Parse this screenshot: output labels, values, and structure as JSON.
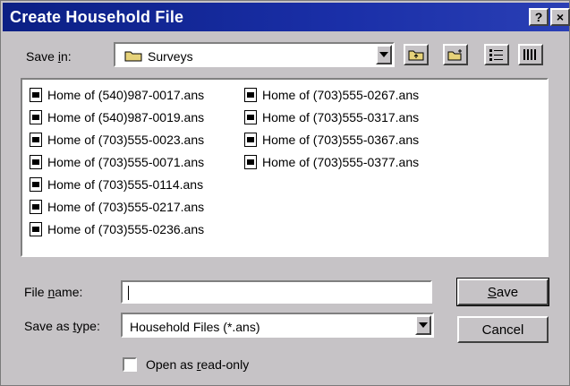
{
  "window": {
    "title": "Create Household File",
    "help_label": "?",
    "close_label": "×"
  },
  "save_in": {
    "label_pre": "Save ",
    "label_u": "i",
    "label_post": "n:",
    "value": "Surveys"
  },
  "toolbar": {
    "up_one_level_icon": "up-folder-icon",
    "new_folder_icon": "new-folder-icon",
    "list_view_icon": "list-view-icon",
    "details_view_icon": "details-view-icon"
  },
  "files": [
    "Home of (540)987-0017.ans",
    "Home of (540)987-0019.ans",
    "Home of (703)555-0023.ans",
    "Home of (703)555-0071.ans",
    "Home of (703)555-0114.ans",
    "Home of (703)555-0217.ans",
    "Home of (703)555-0236.ans",
    "Home of (703)555-0267.ans",
    "Home of (703)555-0317.ans",
    "Home of (703)555-0367.ans",
    "Home of (703)555-0377.ans"
  ],
  "file_name": {
    "label_pre": "File ",
    "label_u": "n",
    "label_post": "ame:",
    "value": ""
  },
  "save_as_type": {
    "label_pre": "Save as ",
    "label_u": "t",
    "label_post": "ype:",
    "value": "Household Files (*.ans)"
  },
  "buttons": {
    "save_u": "S",
    "save_rest": "ave",
    "cancel": "Cancel"
  },
  "read_only": {
    "label_pre": "Open as ",
    "label_u": "r",
    "label_post": "ead-only",
    "checked": false
  }
}
